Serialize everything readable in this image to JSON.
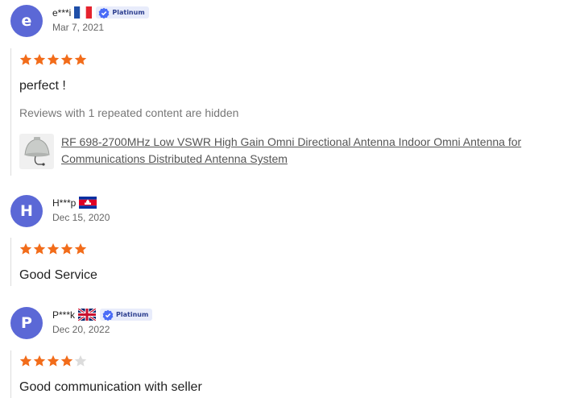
{
  "reviews": [
    {
      "avatar_letter": "e",
      "name": "e***i",
      "flag": "france-flag",
      "badge": "Platinum",
      "date": "Mar 7, 2021",
      "rating": 5,
      "text": "perfect !",
      "hidden_note": "Reviews with 1 repeated content are hidden",
      "product_title": "RF 698-2700MHz Low VSWR High Gain Omni Directional Antenna Indoor Omni Antenna for Communications Distributed Antenna System"
    },
    {
      "avatar_letter": "H",
      "name": "H***p",
      "flag": "cambodia-flag",
      "date": "Dec 15, 2020",
      "rating": 5,
      "text": "Good Service"
    },
    {
      "avatar_letter": "P",
      "name": "P***k",
      "flag": "uk-flag",
      "badge": "Platinum",
      "date": "Dec 20, 2022",
      "rating": 4,
      "text": "Good communication with seller"
    }
  ],
  "colors": {
    "avatar_bg": "#5b68d6",
    "star_filled": "#f26c1a",
    "star_empty": "#dcdcdc",
    "badge_bg": "#e8ecfb",
    "badge_icon": "#4a6cf7"
  }
}
